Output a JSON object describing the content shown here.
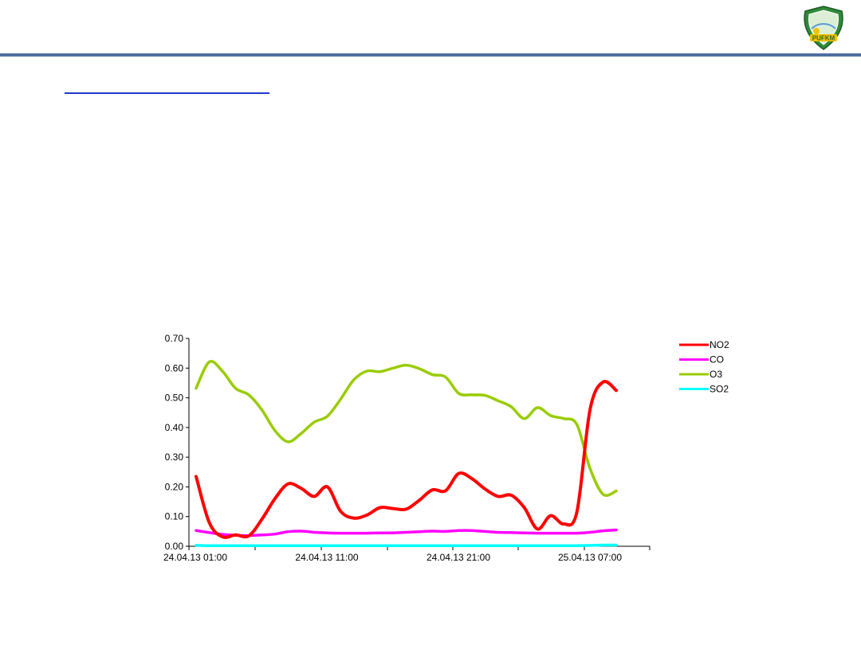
{
  "logo": {
    "text": "PUFKM",
    "icon": "emblem-shield-icon"
  },
  "chart_data": {
    "type": "line",
    "x_labels": [
      "24.04.13 01:00",
      "24.04.13 11:00",
      "24.04.13 21:00",
      "25.04.13 07:00"
    ],
    "ylim": [
      0,
      0.7
    ],
    "y_ticks": [
      "0.00",
      "0.10",
      "0.20",
      "0.30",
      "0.40",
      "0.50",
      "0.60",
      "0.70"
    ],
    "legend_position": "top-right",
    "colors": {
      "NO2": "#ff0000",
      "CO": "#ff00ff",
      "O3": "#99cc00",
      "SO2": "#00ffff"
    },
    "series": [
      {
        "name": "NO2",
        "values": [
          0.235,
          0.08,
          0.032,
          0.038,
          0.035,
          0.09,
          0.16,
          0.21,
          0.195,
          0.168,
          0.2,
          0.118,
          0.095,
          0.105,
          0.13,
          0.127,
          0.125,
          0.155,
          0.19,
          0.187,
          0.245,
          0.228,
          0.193,
          0.168,
          0.172,
          0.13,
          0.058,
          0.103,
          0.075,
          0.115,
          0.46,
          0.553,
          0.525
        ]
      },
      {
        "name": "CO",
        "values": [
          0.053,
          0.046,
          0.04,
          0.037,
          0.036,
          0.038,
          0.041,
          0.049,
          0.051,
          0.047,
          0.045,
          0.044,
          0.044,
          0.044,
          0.045,
          0.045,
          0.047,
          0.049,
          0.051,
          0.05,
          0.053,
          0.053,
          0.05,
          0.047,
          0.046,
          0.045,
          0.044,
          0.044,
          0.044,
          0.044,
          0.047,
          0.052,
          0.055
        ]
      },
      {
        "name": "O3",
        "values": [
          0.532,
          0.621,
          0.59,
          0.532,
          0.51,
          0.46,
          0.39,
          0.352,
          0.38,
          0.418,
          0.438,
          0.495,
          0.56,
          0.59,
          0.588,
          0.6,
          0.61,
          0.598,
          0.578,
          0.57,
          0.515,
          0.51,
          0.508,
          0.49,
          0.47,
          0.43,
          0.467,
          0.44,
          0.43,
          0.41,
          0.262,
          0.175,
          0.186
        ]
      },
      {
        "name": "SO2",
        "values": [
          0.003,
          0.002,
          0.002,
          0.002,
          0.002,
          0.002,
          0.002,
          0.002,
          0.002,
          0.002,
          0.002,
          0.002,
          0.002,
          0.002,
          0.002,
          0.002,
          0.002,
          0.002,
          0.002,
          0.002,
          0.002,
          0.002,
          0.002,
          0.002,
          0.002,
          0.002,
          0.002,
          0.002,
          0.002,
          0.002,
          0.003,
          0.004,
          0.004
        ]
      }
    ]
  }
}
